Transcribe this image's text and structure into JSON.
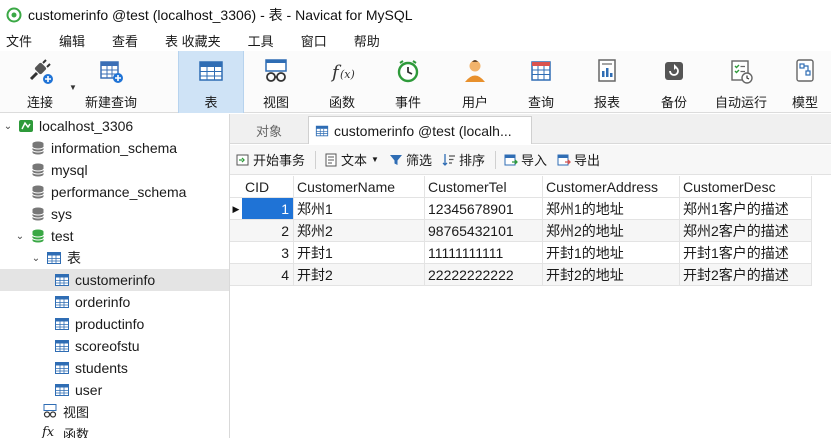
{
  "window": {
    "title": "customerinfo @test (localhost_3306) - 表 - Navicat for MySQL"
  },
  "menu": [
    "文件",
    "编辑",
    "查看",
    "表 收藏夹",
    "工具",
    "窗口",
    "帮助"
  ],
  "toolbar": {
    "items": [
      {
        "label": "连接",
        "icon": "connect-plug-icon"
      },
      {
        "label": "新建查询",
        "icon": "new-query-icon"
      },
      {
        "label": "表",
        "icon": "table-icon"
      },
      {
        "label": "视图",
        "icon": "view-glasses-icon"
      },
      {
        "label": "函数",
        "icon": "function-fx-icon"
      },
      {
        "label": "事件",
        "icon": "event-clock-icon"
      },
      {
        "label": "用户",
        "icon": "user-icon"
      },
      {
        "label": "查询",
        "icon": "query-grid-icon"
      },
      {
        "label": "报表",
        "icon": "report-icon"
      },
      {
        "label": "备份",
        "icon": "backup-icon"
      },
      {
        "label": "自动运行",
        "icon": "schedule-icon"
      },
      {
        "label": "模型",
        "icon": "model-icon"
      }
    ],
    "active": "表"
  },
  "tree": {
    "connection": "localhost_3306",
    "databases": [
      "information_schema",
      "mysql",
      "performance_schema",
      "sys"
    ],
    "open_database": "test",
    "tables_group": "表",
    "tables": [
      "customerinfo",
      "orderinfo",
      "productinfo",
      "scoreofstu",
      "students",
      "user"
    ],
    "selected_table": "customerinfo",
    "views_group": "视图",
    "functions_group": "函数"
  },
  "tabs": {
    "objects": "对象",
    "active": "customerinfo @test (localh..."
  },
  "subtoolbar": {
    "begin_transaction": "开始事务",
    "text": "文本",
    "filter": "筛选",
    "sort": "排序",
    "import": "导入",
    "export": "导出"
  },
  "grid": {
    "columns": [
      "CID",
      "CustomerName",
      "CustomerTel",
      "CustomerAddress",
      "CustomerDesc"
    ],
    "rows": [
      [
        "1",
        "郑州1",
        "12345678901",
        "郑州1的地址",
        "郑州1客户的描述"
      ],
      [
        "2",
        "郑州2",
        "98765432101",
        "郑州2的地址",
        "郑州2客户的描述"
      ],
      [
        "3",
        "开封1",
        "11111111111",
        "开封1的地址",
        "开封1客户的描述"
      ],
      [
        "4",
        "开封2",
        "22222222222",
        "开封2的地址",
        "开封2客户的描述"
      ]
    ]
  },
  "colors": {
    "accent": "#1f73d6",
    "toolbar_active": "#cfe3f6",
    "db_open_green": "#3aa845"
  }
}
